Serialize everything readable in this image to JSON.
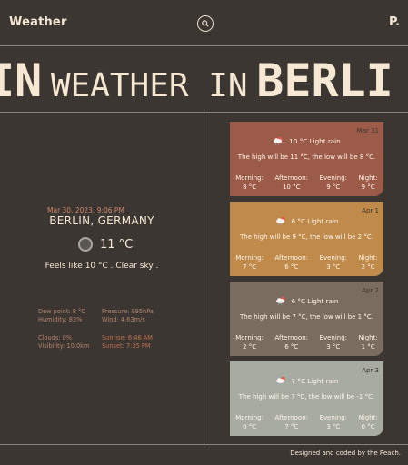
{
  "header": {
    "brand": "Weather",
    "profile_initial": "P."
  },
  "hero": {
    "prefix": "IN",
    "middle": "WEATHER IN",
    "city": "BERLI"
  },
  "current": {
    "datetime": "Mar 30, 2023, 9:06 PM",
    "city": "BERLIN, GERMANY",
    "temp": "11 °C",
    "feels": "Feels like 10 °C . Clear sky .",
    "dew": "Dew point: 8 °C",
    "humidity": "Humidity: 83%",
    "pressure": "Pressure: 995hPa",
    "wind": "Wind: 4.63m/s",
    "clouds": "Clouds: 0%",
    "visibility": "Visibility: 10.0km",
    "sunrise": "Sunrise: 6:46 AM",
    "sunset": "Sunset: 7:35 PM"
  },
  "forecast": [
    {
      "date": "Mar 31",
      "summary": "10 °C Light rain",
      "hilo": "The high will be 11 °C, the low will be 8 °C.",
      "parts": [
        {
          "label": "Morning:",
          "value": "8 °C"
        },
        {
          "label": "Afternoon:",
          "value": "10 °C"
        },
        {
          "label": "Evening:",
          "value": "9 °C"
        },
        {
          "label": "Night:",
          "value": "9 °C"
        }
      ],
      "color": "#9c5a48"
    },
    {
      "date": "Apr 1",
      "summary": "6 °C Light rain",
      "hilo": "The high will be 9 °C, the low will be 2 °C.",
      "parts": [
        {
          "label": "Morning:",
          "value": "7 °C"
        },
        {
          "label": "Afternoon:",
          "value": "6 °C"
        },
        {
          "label": "Evening:",
          "value": "3 °C"
        },
        {
          "label": "Night:",
          "value": "2 °C"
        }
      ],
      "color": "#bf8a4a"
    },
    {
      "date": "Apr 2",
      "summary": "6 °C Light rain",
      "hilo": "The high will be 7 °C, the low will be 1 °C.",
      "parts": [
        {
          "label": "Morning:",
          "value": "2 °C"
        },
        {
          "label": "Afternoon:",
          "value": "6 °C"
        },
        {
          "label": "Evening:",
          "value": "3 °C"
        },
        {
          "label": "Night:",
          "value": "1 °C"
        }
      ],
      "color": "#7a6c5f"
    },
    {
      "date": "Apr 3",
      "summary": "7 °C Light rain",
      "hilo": "The high will be 7 °C, the low will be -1 °C.",
      "parts": [
        {
          "label": "Morning:",
          "value": "0 °C"
        },
        {
          "label": "Afternoon:",
          "value": "7 °C"
        },
        {
          "label": "Evening:",
          "value": "3 °C"
        },
        {
          "label": "Night:",
          "value": "0 °C"
        }
      ],
      "color": "#a8aba1"
    }
  ],
  "footer": {
    "credit": "Designed and coded by the Peach."
  }
}
